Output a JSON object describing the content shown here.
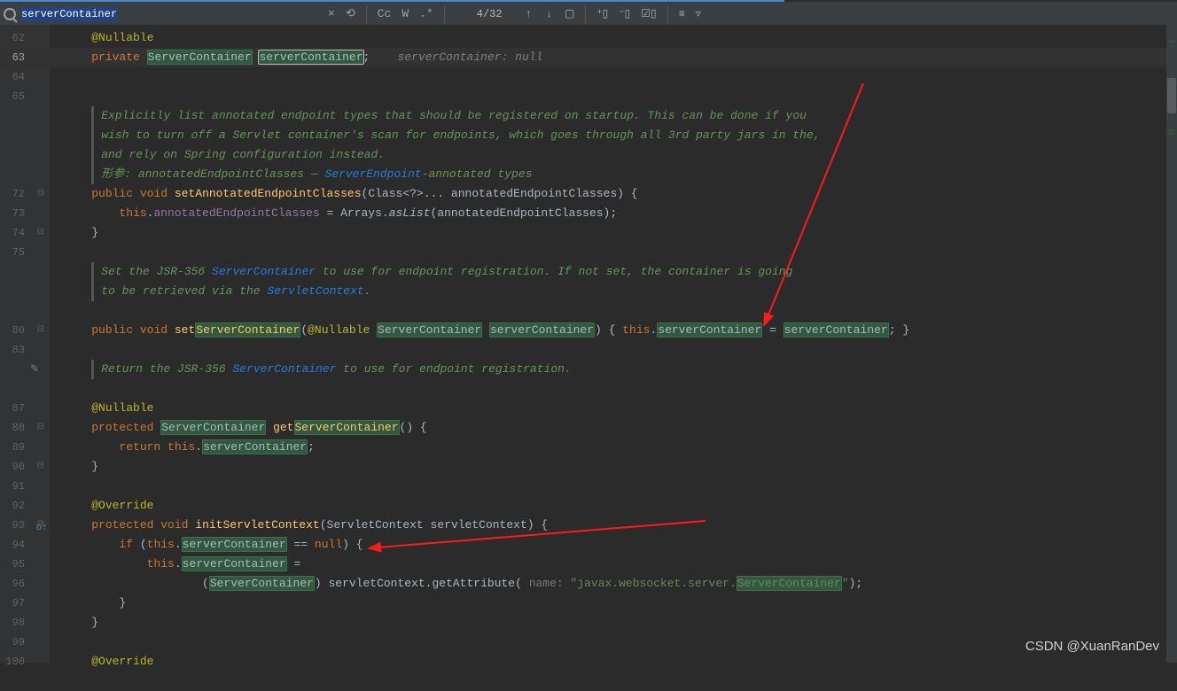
{
  "find": {
    "query": "serverContainer",
    "count": "4/32",
    "close": "×",
    "cc": "Cc",
    "w": "W",
    "regex": ".*"
  },
  "gutter": {
    "l": [
      "62",
      "63",
      "64",
      "65",
      "",
      "",
      "",
      "",
      "72",
      "73",
      "74",
      "75",
      "",
      "",
      "",
      "80",
      "83",
      "",
      "",
      "87",
      "88",
      "89",
      "90",
      "91",
      "92",
      "93",
      "94",
      "95",
      "96",
      "97",
      "98",
      "99",
      "100",
      ""
    ]
  },
  "code": {
    "l62_anno": "@Nullable",
    "l63_kw_private": "private",
    "l63_type": "ServerContainer",
    "l63_field": "serverContainer",
    "l63_semicolon": ";",
    "l63_hint": "serverContainer: null",
    "doc1_a": "Explicitly list annotated endpoint types that should be registered on startup. This can be done if you",
    "doc1_b": "wish to turn off a Servlet container's scan for endpoints, which goes through all 3rd party jars in the,",
    "doc1_c": "and rely on Spring configuration instead.",
    "doc1_d_pre": "形参: ",
    "doc1_d_param": "annotatedEndpointClasses",
    "doc1_d_mid": " — ",
    "doc1_d_link": "ServerEndpoint",
    "doc1_d_post": "-annotated types",
    "l72_kw_public": "public",
    "l72_kw_void": "void",
    "l72_fn": "setAnnotatedEndpointClasses",
    "l72_sig": "(Class<?>... annotatedEndpointClasses) {",
    "l73": "        this.annotatedEndpointClasses = Arrays.asList(annotatedEndpointClasses);",
    "l73_this": "this",
    "l73_dot1": ".",
    "l73_field": "annotatedEndpointClasses",
    "l73_mid": " = Arrays.",
    "l73_asList": "asList",
    "l73_end": "(annotatedEndpointClasses);",
    "l74": "    }",
    "doc2_a_pre": "Set the JSR-356 ",
    "doc2_a_link": "ServerContainer",
    "doc2_a_post": " to use for endpoint registration. If not set, the container is going",
    "doc2_b_pre": "to be retrieved via the ",
    "doc2_b_link": "ServletContext",
    "doc2_b_post": ".",
    "l80_kw_public": "public",
    "l80_kw_void": "void",
    "l80_fn_set": "set",
    "l80_fn_SC": "ServerContainer",
    "l80_paren_open": "(",
    "l80_nullable": "@Nullable",
    "l80_ptype": "ServerContainer",
    "l80_pname": "serverContainer",
    "l80_paren_close": ")",
    "l80_brace": " { ",
    "l80_this": "this",
    "l80_dot": ".",
    "l80_f_sc": "serverContainer",
    "l80_eq": " = ",
    "l80_rhs": "serverContainer",
    "l80_end": "; }",
    "doc3_pre": "Return the JSR-356 ",
    "doc3_link": "ServerContainer",
    "doc3_post": " to use for endpoint registration.",
    "l87": "@Nullable",
    "l88_kw": "protected",
    "l88_type": "ServerContainer",
    "l88_get": " get",
    "l88_SC": "ServerContainer",
    "l88_end": "() {",
    "l89_ret": "return",
    "l89_this": "this",
    "l89_dot": ".",
    "l89_sc": "serverContainer",
    "l89_semi": ";",
    "l90": "    }",
    "l92": "@Override",
    "l93_kw": "protected",
    "l93_void": "void",
    "l93_fn": "initServletContext",
    "l93_sig": "(ServletContext servletContext) {",
    "l94_if": "if",
    "l94_open": " (",
    "l94_this": "this",
    "l94_dot": ".",
    "l94_sc": "serverContainer",
    "l94_eqeq": " == ",
    "l94_null": "null",
    "l94_close": ") {",
    "l95_this": "this",
    "l95_dot": ".",
    "l95_sc": "serverContainer",
    "l95_eq": " =",
    "l96_open": "                (",
    "l96_cast": "ServerContainer",
    "l96_mid": ") servletContext.getAttribute( ",
    "l96_hint": "name: ",
    "l96_str_a": "\"javax.websocket.server.",
    "l96_str_b": "ServerContainer",
    "l96_str_c": "\"",
    "l96_end": ");",
    "l97": "        }",
    "l98": "    }",
    "l100": "@Override"
  },
  "watermark": "CSDN @XuanRanDev"
}
